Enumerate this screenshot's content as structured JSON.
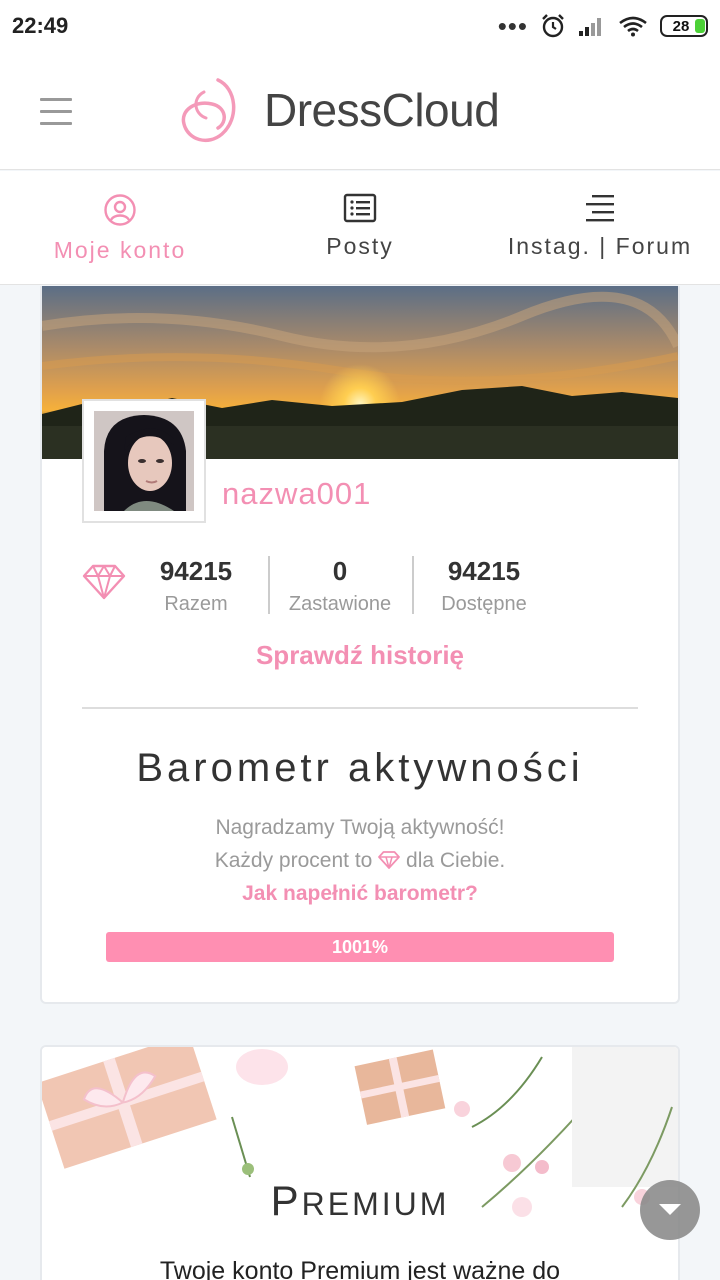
{
  "status": {
    "time": "22:49",
    "battery": "28"
  },
  "brand": {
    "name": "DressCloud"
  },
  "tabs": [
    {
      "label": "Moje konto",
      "icon": "user-circle-icon",
      "active": true
    },
    {
      "label": "Posty",
      "icon": "list-icon",
      "active": false
    },
    {
      "label": "Instag. | Forum",
      "icon": "menu-lines-icon",
      "active": false
    }
  ],
  "profile": {
    "username": "nazwa001",
    "stats": [
      {
        "value": "94215",
        "label": "Razem"
      },
      {
        "value": "0",
        "label": "Zastawione"
      },
      {
        "value": "94215",
        "label": "Dostępne"
      }
    ],
    "history_link": "Sprawdź historię"
  },
  "barometer": {
    "title": "Barometr aktywności",
    "line1": "Nagradzamy Twoją aktywność!",
    "line2_before": "Każdy procent to",
    "line2_after": "dla Ciebie.",
    "link": "Jak napełnić barometr?",
    "progress_label": "1001%",
    "progress_fraction": 1.0
  },
  "premium": {
    "title_cap": "P",
    "title_rest": "REMIUM",
    "text": "Twoje konto Premium jest ważne do"
  },
  "colors": {
    "accent": "#f38fb3",
    "progress": "#ff8fb2"
  }
}
